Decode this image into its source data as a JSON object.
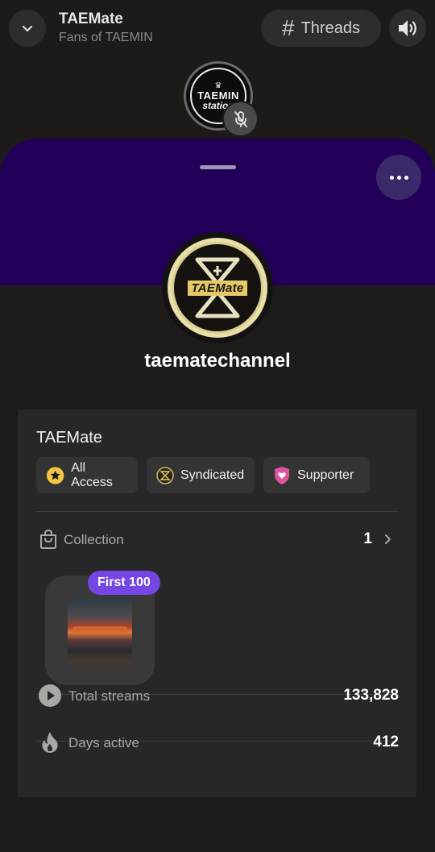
{
  "header": {
    "title": "TAEMate",
    "subtitle": "Fans of TAEMIN",
    "threads_label": "Threads",
    "station_logo_text": [
      "TAEMIN",
      "station"
    ]
  },
  "channel": {
    "logo_text": "TAEMate",
    "name": "taematechannel"
  },
  "card": {
    "title": "TAEMate",
    "chips": [
      {
        "label": "All Access",
        "icon": "star-icon",
        "color": "#f5c542"
      },
      {
        "label": "Syndicated",
        "icon": "syndicated-icon",
        "color": "#c9b86a"
      },
      {
        "label": "Supporter",
        "icon": "heart-shield-icon",
        "color": "#e0539e"
      }
    ],
    "collection": {
      "label": "Collection",
      "count": "1",
      "items": [
        {
          "badge": "First 100"
        }
      ]
    },
    "stats": [
      {
        "label": "Total streams",
        "value": "133,828",
        "icon": "play-icon"
      },
      {
        "label": "Days active",
        "value": "412",
        "icon": "fire-icon"
      }
    ]
  },
  "colors": {
    "banner": "#22005a",
    "badge": "#7446e4",
    "background": "#1c1b19",
    "card": "#282727"
  }
}
